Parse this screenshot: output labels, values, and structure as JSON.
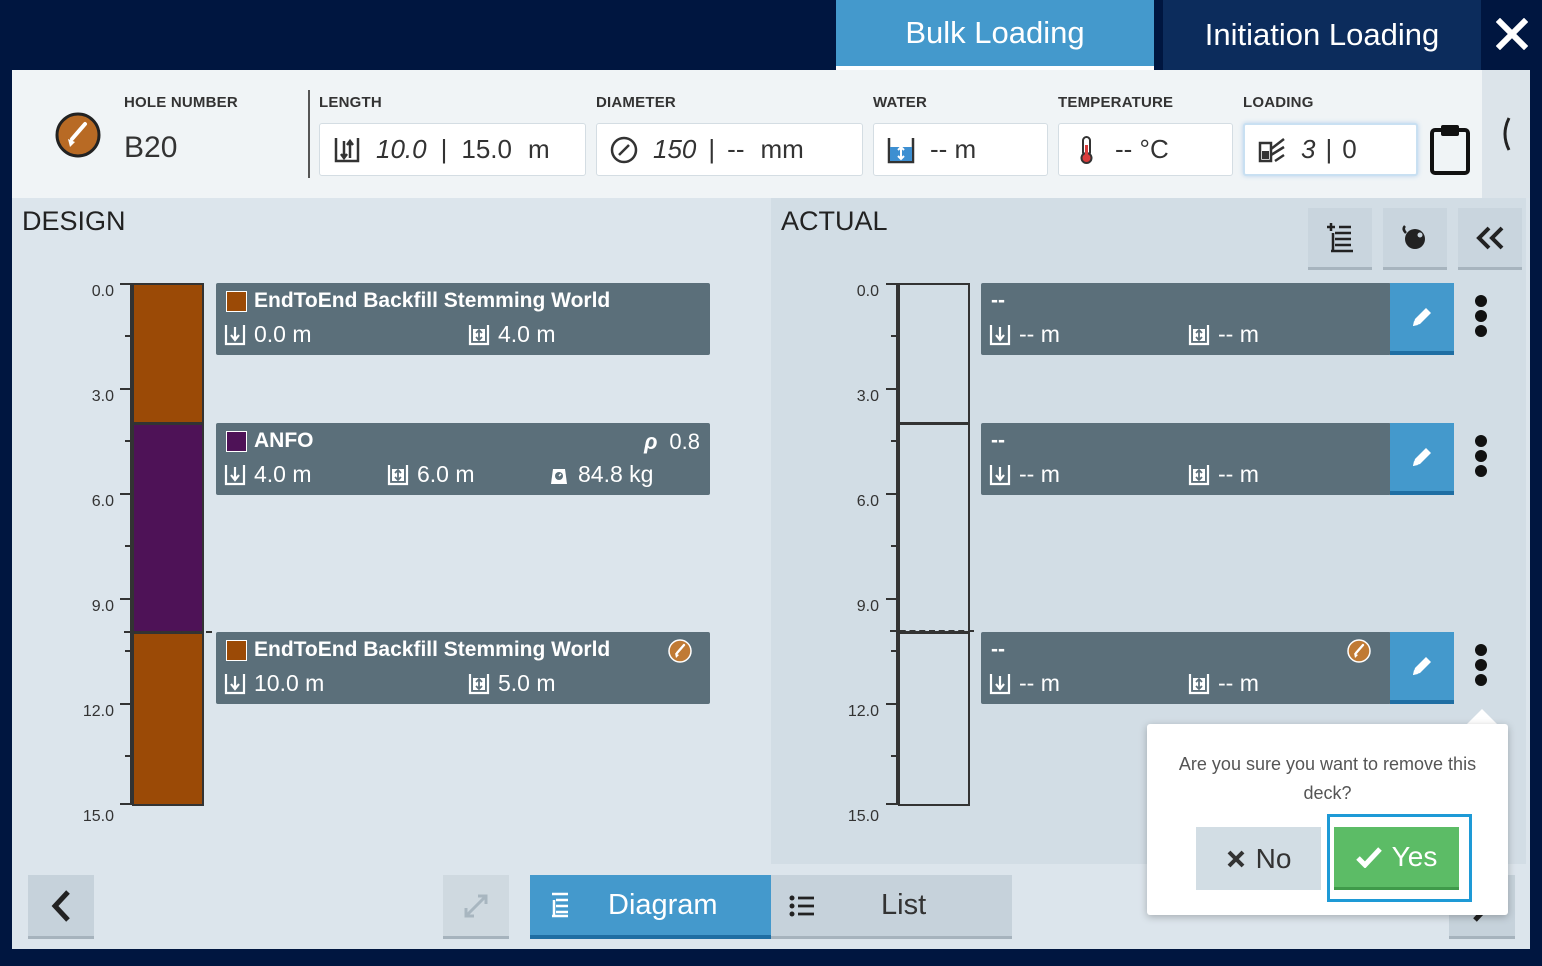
{
  "tabs": [
    {
      "label": "Bulk Loading",
      "active": true
    },
    {
      "label": "Initiation Loading",
      "active": false
    }
  ],
  "header": {
    "hole_number_label": "HOLE NUMBER",
    "hole_number": "B20",
    "length_label": "LENGTH",
    "length_value": "10.0",
    "length_sep": "|",
    "length_total": "15.0",
    "length_unit": "m",
    "diameter_label": "DIAMETER",
    "diameter_value": "150",
    "diameter_sep": "|",
    "diameter_actual": "--",
    "diameter_unit": "mm",
    "water_label": "WATER",
    "water_value": "-- m",
    "temperature_label": "TEMPERATURE",
    "temperature_value": "-- °C",
    "loading_label": "LOADING",
    "loading_value": "3",
    "loading_sep": "|",
    "loading_value2": "0"
  },
  "design": {
    "title": "DESIGN",
    "ticks": [
      "0.0",
      "3.0",
      "6.0",
      "9.0",
      "12.0",
      "15.0"
    ],
    "decks": [
      {
        "name": "EndToEnd Backfill Stemming World",
        "color": "#9b4a06",
        "depth": "0.0 m",
        "length": "4.0 m"
      },
      {
        "name": "ANFO",
        "color": "#4e1257",
        "density_label": "ρ",
        "density": "0.8",
        "depth": "4.0 m",
        "length": "6.0 m",
        "mass": "84.8 kg"
      },
      {
        "name": "EndToEnd Backfill Stemming World",
        "color": "#9b4a06",
        "depth": "10.0 m",
        "length": "5.0 m"
      }
    ]
  },
  "actual": {
    "title": "ACTUAL",
    "ticks": [
      "0.0",
      "3.0",
      "6.0",
      "9.0",
      "12.0",
      "15.0"
    ],
    "decks": [
      {
        "name": "--",
        "depth": "-- m",
        "length": "-- m"
      },
      {
        "name": "--",
        "depth": "-- m",
        "length": "-- m"
      },
      {
        "name": "--",
        "depth": "-- m",
        "length": "-- m"
      }
    ]
  },
  "popup": {
    "message": "Are you sure you want to remove this deck?",
    "no_label": "No",
    "yes_label": "Yes"
  },
  "bottom": {
    "diagram_label": "Diagram",
    "list_label": "List"
  },
  "colors": {
    "accent": "#4499cc",
    "stemming": "#9b4a06",
    "anfo": "#4e1257",
    "confirm": "#5cbc66"
  }
}
